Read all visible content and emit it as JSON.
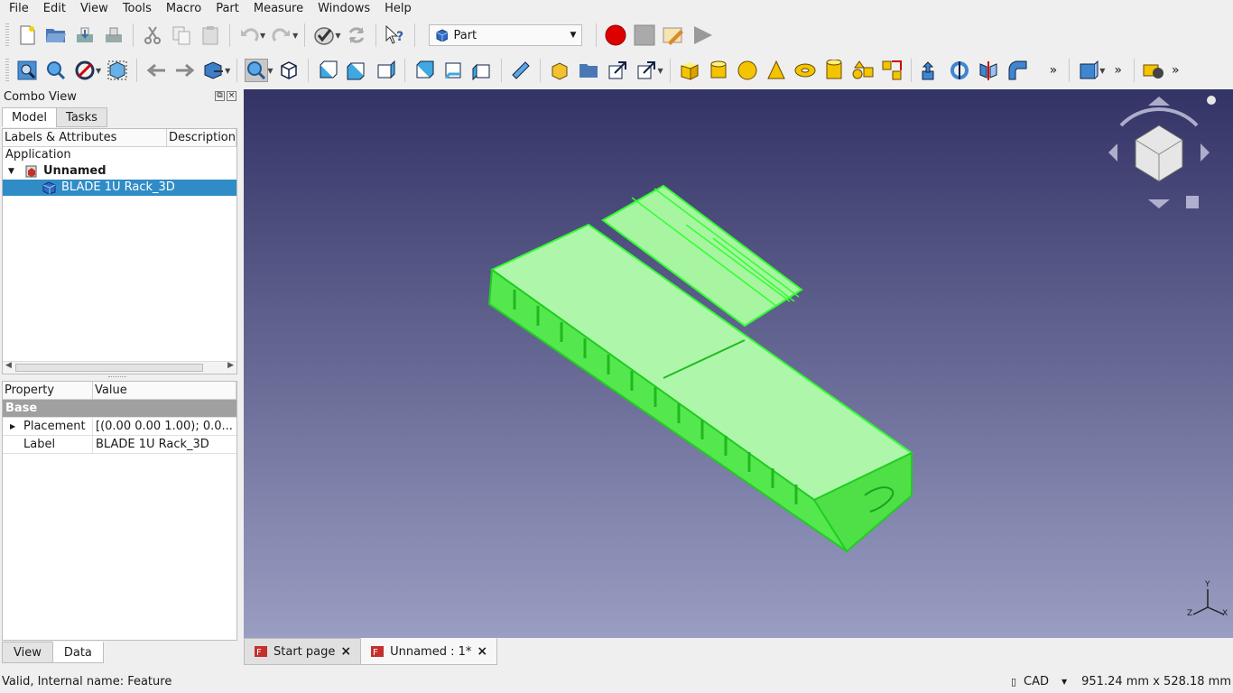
{
  "menu": [
    "File",
    "Edit",
    "View",
    "Tools",
    "Macro",
    "Part",
    "Measure",
    "Windows",
    "Help"
  ],
  "workbench": {
    "selected": "Part"
  },
  "combo": {
    "title": "Combo View",
    "tabs": [
      "Model",
      "Tasks"
    ]
  },
  "tree": {
    "col_labels": "Labels & Attributes",
    "col_desc": "Description",
    "app": "Application",
    "doc": "Unnamed",
    "item": "BLADE 1U Rack_3D"
  },
  "props": {
    "col_prop": "Property",
    "col_value": "Value",
    "group": "Base",
    "rows": [
      {
        "name": "Placement",
        "value": "[(0.00 0.00 1.00); 0.0..."
      },
      {
        "name": "Label",
        "value": "BLADE 1U Rack_3D"
      }
    ]
  },
  "bottom_tabs": [
    "View",
    "Data"
  ],
  "doc_tabs": [
    "Start page",
    "Unnamed : 1*"
  ],
  "status": {
    "message": "Valid, Internal name: Feature",
    "nav": "CAD",
    "dims": "951.24 mm x 528.18 mm"
  },
  "axes": {
    "x": "X",
    "y": "Y",
    "z": "Z"
  },
  "colors": {
    "model": "#33ff33",
    "selection": "#308cc6"
  }
}
